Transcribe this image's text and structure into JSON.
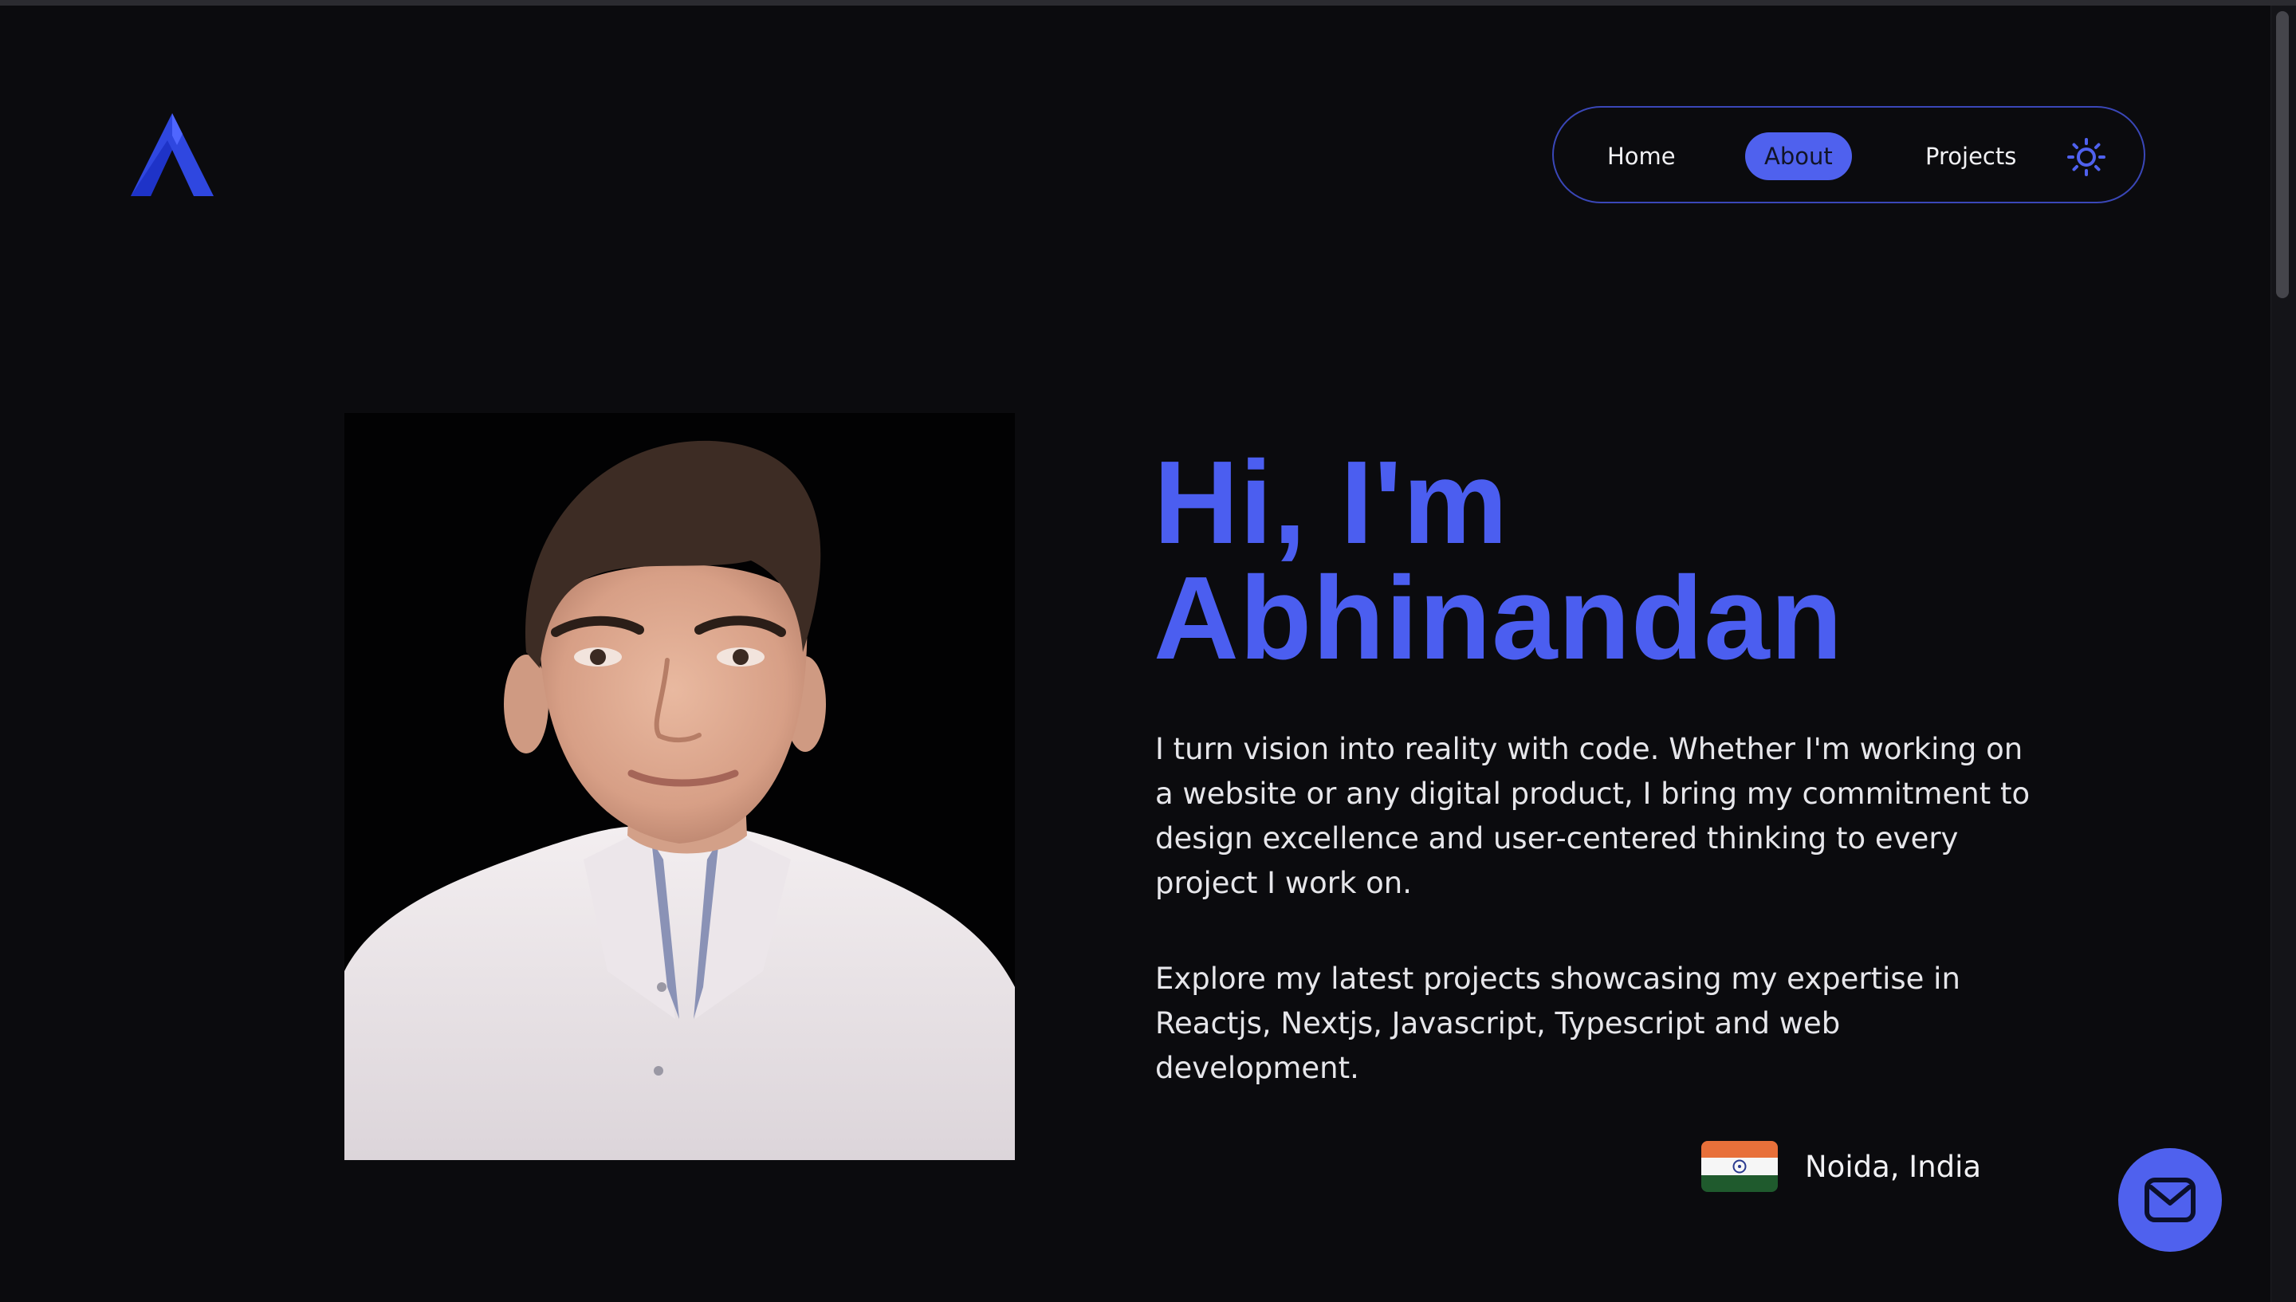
{
  "nav": {
    "home_label": "Home",
    "about_label": "About",
    "projects_label": "Projects",
    "active": "About"
  },
  "hero": {
    "title_line1": "Hi, I'm",
    "title_line2": "Abhinandan",
    "intro": "I turn vision into reality with code. Whether I'm working on a website or any digital product, I bring my commitment to design excellence and user-centered thinking to every project I work on.",
    "explore": "Explore my latest projects showcasing my expertise in Reactjs, Nextjs, Javascript, Typescript and web development."
  },
  "location": {
    "text": "Noida, India",
    "flag": "india-flag"
  },
  "icons": {
    "logo": "brand-a-logo",
    "theme": "sun-icon",
    "contact": "mail-icon"
  },
  "colors": {
    "background": "#0b0b0e",
    "accent": "#4f61ee",
    "heading": "#4b5ef0",
    "text": "#e6e6ea"
  }
}
